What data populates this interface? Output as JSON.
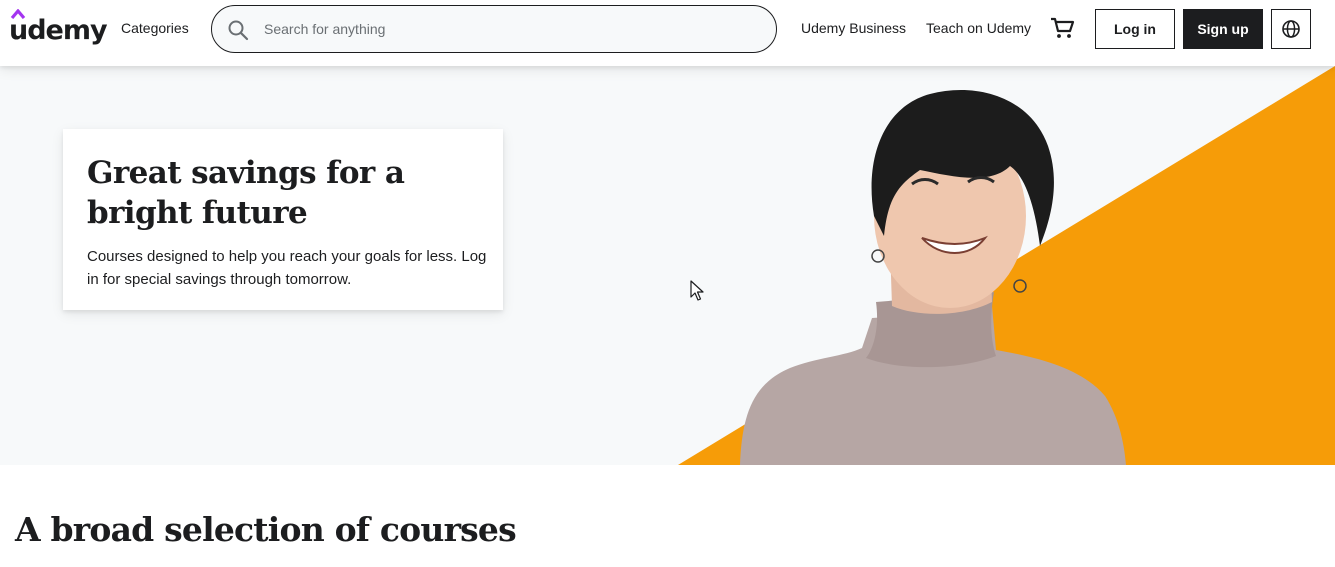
{
  "brand": {
    "name": "udemy",
    "accent": "#a435f0"
  },
  "header": {
    "categories": "Categories",
    "search": {
      "placeholder": "Search for anything",
      "value": ""
    },
    "links": {
      "business": "Udemy Business",
      "teach": "Teach on Udemy"
    },
    "login_label": "Log in",
    "signup_label": "Sign up",
    "icons": {
      "search": "search-icon",
      "cart": "cart-icon",
      "language": "globe-icon"
    }
  },
  "hero": {
    "title": "Great savings for a bright future",
    "subtitle": "Courses designed to help you reach your goals for less. Log in for special savings through tomorrow.",
    "accent_color": "#f69c08",
    "background_color": "#f7f9fa"
  },
  "section": {
    "title": "A broad selection of courses"
  },
  "colors": {
    "text": "#1c1d1f",
    "button_dark": "#1c1d1f"
  }
}
